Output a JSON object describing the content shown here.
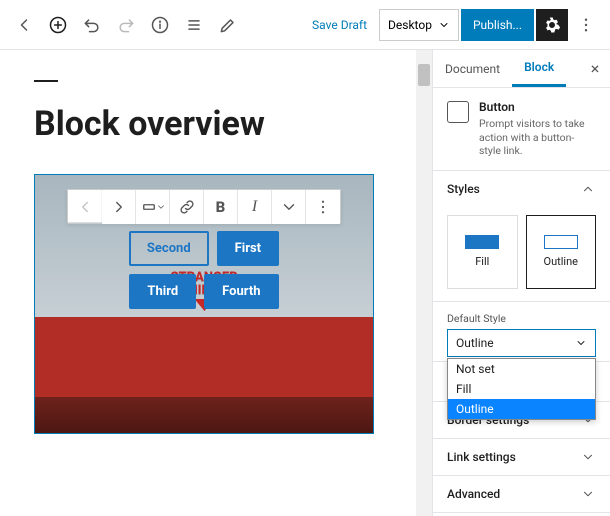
{
  "topbar": {
    "save_draft": "Save Draft",
    "preview_mode": "Desktop",
    "publish": "Publish..."
  },
  "editor": {
    "title": "Block overview",
    "buttons": [
      "Second",
      "First",
      "Third",
      "Fourth"
    ],
    "selected_index": 0,
    "sign": {
      "line1": "STRANGER",
      "line2": "THINGS"
    }
  },
  "block_toolbar": {
    "items": [
      "move-left",
      "move-right",
      "button-block",
      "link",
      "bold",
      "italic",
      "chevron-down",
      "more"
    ]
  },
  "sidebar": {
    "tabs": {
      "document": "Document",
      "block": "Block",
      "active": "block"
    },
    "block": {
      "name": "Button",
      "description": "Prompt visitors to take action with a button-style link."
    },
    "styles": {
      "heading": "Styles",
      "options": [
        {
          "key": "fill",
          "label": "Fill"
        },
        {
          "key": "outline",
          "label": "Outline"
        }
      ],
      "selected": "outline",
      "default_label": "Default Style",
      "default_value": "Outline",
      "dropdown": [
        "Not set",
        "Fill",
        "Outline"
      ],
      "dropdown_highlight": 2
    },
    "panels": {
      "border": "Border settings",
      "link": "Link settings",
      "advanced": "Advanced"
    }
  }
}
